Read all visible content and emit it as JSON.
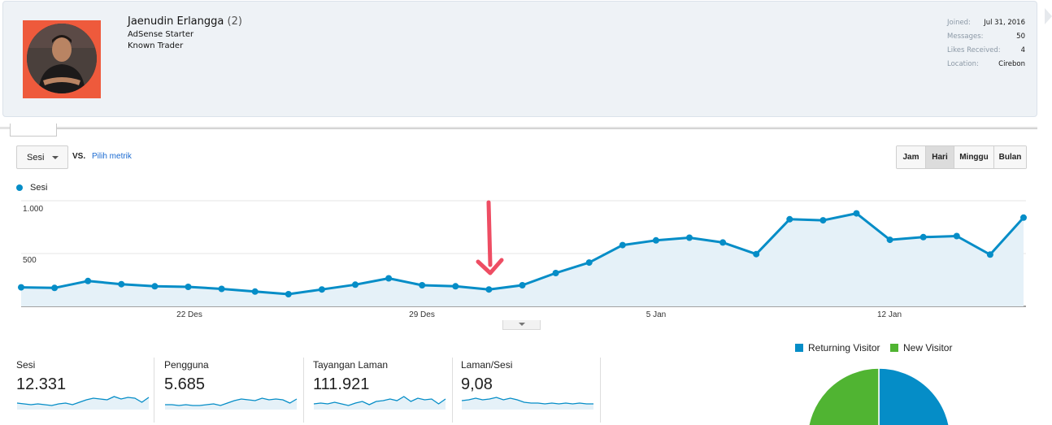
{
  "profile": {
    "name": "Jaenudin Erlangga",
    "post_count": "(2)",
    "titles": [
      "AdSense Starter",
      "Known Trader"
    ],
    "stats": [
      {
        "label": "Joined:",
        "value": "Jul 31, 2016"
      },
      {
        "label": "Messages:",
        "value": "50"
      },
      {
        "label": "Likes Received:",
        "value": "4"
      },
      {
        "label": "Location:",
        "value": "Cirebon"
      }
    ]
  },
  "toolbar": {
    "metric_select": "Sesi",
    "vs_label": "VS.",
    "pick_metric": "Pilih metrik",
    "periods": [
      "Jam",
      "Hari",
      "Minggu",
      "Bulan"
    ],
    "active_period": "Hari"
  },
  "colors": {
    "series": "#058dc7",
    "returning": "#058dc7",
    "new": "#50b432",
    "arrow": "#ee4d63"
  },
  "chart_data": {
    "type": "line",
    "series": [
      {
        "name": "Sesi",
        "values": [
          180,
          175,
          240,
          210,
          190,
          185,
          165,
          140,
          115,
          160,
          205,
          265,
          200,
          190,
          160,
          200,
          315,
          415,
          580,
          625,
          650,
          605,
          495,
          825,
          815,
          880,
          630,
          655,
          665,
          490,
          840
        ]
      }
    ],
    "x_tick_labels": [
      "22 Des",
      "29 Des",
      "5 Jan",
      "12 Jan"
    ],
    "y_tick_labels": [
      "1.000",
      "500"
    ],
    "ylim": [
      0,
      1000
    ],
    "legend": "top-left",
    "grid": true,
    "annotation": "red arrow pointing down at the low point around 30 Des"
  },
  "kpis": [
    {
      "label": "Sesi",
      "value": "12.331",
      "spark": [
        8,
        7,
        6,
        7,
        6,
        5,
        7,
        8,
        6,
        9,
        12,
        14,
        13,
        12,
        16,
        13,
        15,
        14,
        9,
        15
      ]
    },
    {
      "label": "Pengguna",
      "value": "5.685",
      "spark": [
        6,
        6,
        5,
        6,
        5,
        5,
        6,
        7,
        5,
        8,
        11,
        13,
        12,
        11,
        14,
        12,
        13,
        12,
        8,
        13
      ]
    },
    {
      "label": "Tayangan Laman",
      "value": "111.921",
      "spark": [
        7,
        8,
        7,
        9,
        7,
        5,
        8,
        10,
        6,
        10,
        11,
        13,
        11,
        16,
        10,
        14,
        12,
        13,
        7,
        13
      ]
    },
    {
      "label": "Laman/Sesi",
      "value": "9,08",
      "spark": [
        11,
        12,
        14,
        12,
        13,
        15,
        12,
        14,
        12,
        9,
        8,
        8,
        7,
        8,
        7,
        8,
        7,
        8,
        7,
        7
      ]
    }
  ],
  "pie": {
    "legend": [
      "Returning Visitor",
      "New Visitor"
    ]
  }
}
